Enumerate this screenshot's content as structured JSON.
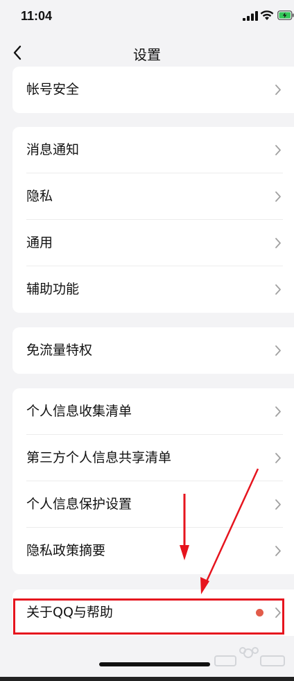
{
  "status_bar": {
    "time": "11:04"
  },
  "nav": {
    "title": "设置",
    "back_icon": "chevron-left-icon"
  },
  "groups": [
    {
      "items": [
        {
          "label": "帐号安全"
        }
      ]
    },
    {
      "items": [
        {
          "label": "消息通知"
        },
        {
          "label": "隐私"
        },
        {
          "label": "通用"
        },
        {
          "label": "辅助功能"
        }
      ]
    },
    {
      "items": [
        {
          "label": "免流量特权"
        }
      ]
    },
    {
      "items": [
        {
          "label": "个人信息收集清单"
        },
        {
          "label": "第三方个人信息共享清单"
        },
        {
          "label": "个人信息保护设置"
        },
        {
          "label": "隐私政策摘要"
        }
      ]
    },
    {
      "items": [
        {
          "label": "关于QQ与帮助",
          "has_red_dot": true
        }
      ]
    }
  ],
  "colors": {
    "background": "#f3f3f5",
    "card": "#ffffff",
    "red_dot": "#e25c4a",
    "annotation_red": "#e6141e"
  },
  "icons": {
    "row_chevron": "chevron-right-icon",
    "signal": "cellular-signal-icon",
    "wifi": "wifi-icon",
    "battery": "battery-charging-icon"
  }
}
